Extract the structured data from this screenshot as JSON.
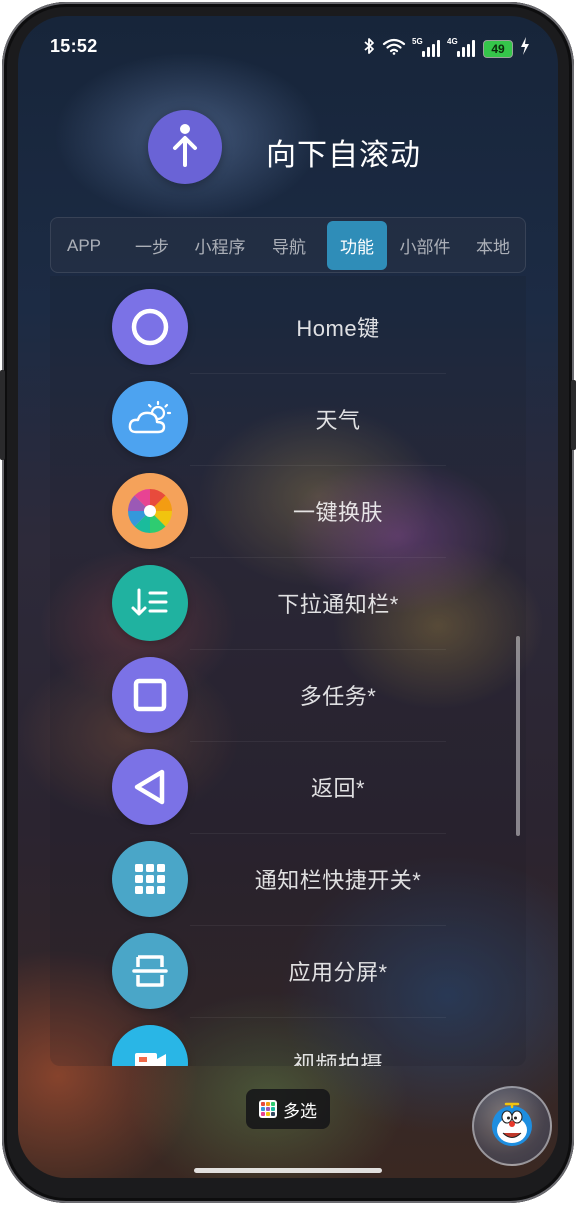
{
  "status_bar": {
    "time": "15:52",
    "net1": "5G",
    "net2": "4G",
    "battery": "49",
    "icons": [
      "bluetooth-icon",
      "wifi-icon",
      "signal-5g-icon",
      "signal-4g-icon",
      "battery-icon",
      "charging-icon"
    ]
  },
  "header": {
    "title": "向下自滚动",
    "icon": "arrow-up-icon",
    "icon_color": "#6a63d6"
  },
  "tabs": [
    {
      "label": "APP",
      "active": false
    },
    {
      "label": "一步",
      "active": false
    },
    {
      "label": "小程序",
      "active": false
    },
    {
      "label": "导航",
      "active": false
    },
    {
      "label": "功能",
      "active": true
    },
    {
      "label": "小部件",
      "active": false
    },
    {
      "label": "本地",
      "active": false
    }
  ],
  "tab_active_color": "#2f8db8",
  "items": [
    {
      "label": "Home键",
      "icon": "home-circle-icon",
      "color": "#7b72e6"
    },
    {
      "label": "天气",
      "icon": "weather-icon",
      "color": "#4da3f0"
    },
    {
      "label": "一键换肤",
      "icon": "skin-pinwheel-icon",
      "color": "#f5a25a"
    },
    {
      "label": "下拉通知栏*",
      "icon": "notification-pull-icon",
      "color": "#20b2a0"
    },
    {
      "label": "多任务*",
      "icon": "multitask-square-icon",
      "color": "#7b72e6"
    },
    {
      "label": "返回*",
      "icon": "back-triangle-icon",
      "color": "#7b72e6"
    },
    {
      "label": "通知栏快捷开关*",
      "icon": "quick-toggles-grid-icon",
      "color": "#4aa6c8"
    },
    {
      "label": "应用分屏*",
      "icon": "split-screen-icon",
      "color": "#4aa6c8"
    },
    {
      "label": "视频拍摄",
      "icon": "video-camera-icon",
      "color": "#29b6e6"
    }
  ],
  "bottom": {
    "multi_select_label": "多选",
    "avatar_icon": "doraemon-avatar-icon"
  }
}
